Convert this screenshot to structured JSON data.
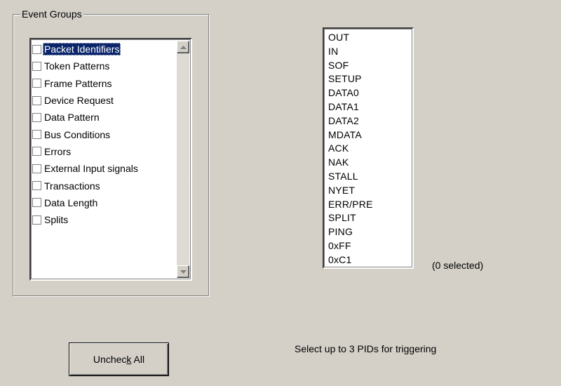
{
  "event_groups": {
    "legend": "Event Groups",
    "items": [
      {
        "label": "Packet Identifiers",
        "checked": false,
        "selected": true
      },
      {
        "label": "Token Patterns",
        "checked": false,
        "selected": false
      },
      {
        "label": "Frame Patterns",
        "checked": false,
        "selected": false
      },
      {
        "label": "Device Request",
        "checked": false,
        "selected": false
      },
      {
        "label": "Data Pattern",
        "checked": false,
        "selected": false
      },
      {
        "label": "Bus Conditions",
        "checked": false,
        "selected": false
      },
      {
        "label": "Errors",
        "checked": false,
        "selected": false
      },
      {
        "label": "External Input signals",
        "checked": false,
        "selected": false
      },
      {
        "label": "Transactions",
        "checked": false,
        "selected": false
      },
      {
        "label": "Data Length",
        "checked": false,
        "selected": false
      },
      {
        "label": "Splits",
        "checked": false,
        "selected": false
      }
    ]
  },
  "pid_list": {
    "items": [
      "OUT",
      "IN",
      "SOF",
      "SETUP",
      "DATA0",
      "DATA1",
      "DATA2",
      "MDATA",
      "ACK",
      "NAK",
      "STALL",
      "NYET",
      "ERR/PRE",
      "SPLIT",
      "PING",
      "0xFF",
      "0xC1"
    ],
    "selected_count_text": "(0 selected)"
  },
  "uncheck_button": {
    "label_before": "Unchec",
    "label_accel": "k",
    "label_after": " All"
  },
  "hint": "Select up to 3 PIDs for triggering",
  "colors": {
    "dialog_bg": "#d4d0c8",
    "selection_bg": "#0a246a",
    "selection_text": "#ffffff"
  }
}
